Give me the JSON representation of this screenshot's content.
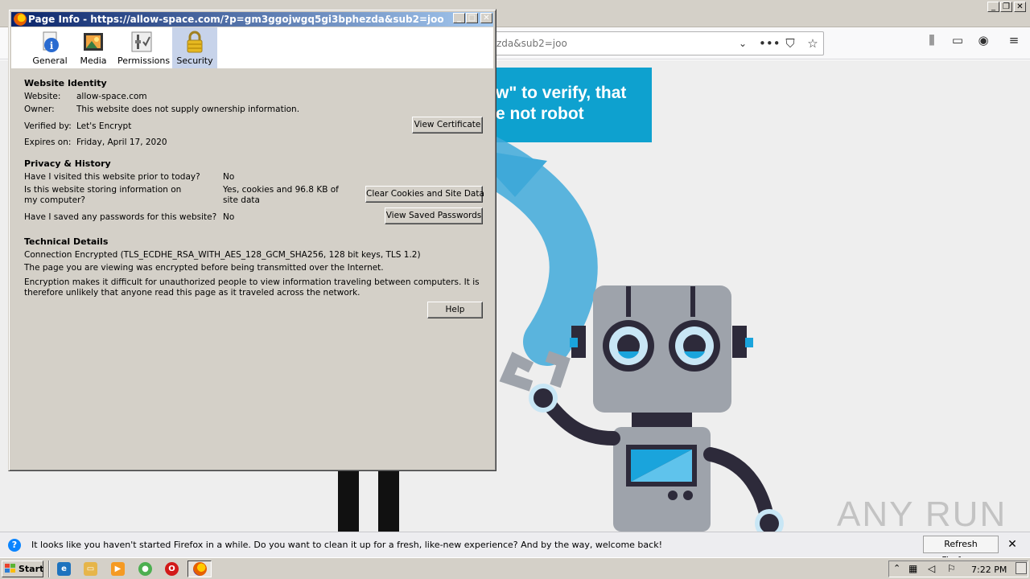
{
  "firefox": {
    "url_partial": "zda&sub2=joo",
    "page": {
      "banner_line1": "w\" to verify, that",
      "banner_line2": "e not robot"
    },
    "watermark": "ANY RUN"
  },
  "dialog": {
    "title": "Page Info - https://allow-space.com/?p=gm3ggojwgq5gi3bphezda&sub2=joo",
    "tabs": [
      {
        "label": "General",
        "icon": "info-icon"
      },
      {
        "label": "Media",
        "icon": "media-icon"
      },
      {
        "label": "Permissions",
        "icon": "permissions-icon"
      },
      {
        "label": "Security",
        "icon": "lock-icon",
        "selected": true
      }
    ],
    "identity": {
      "heading": "Website Identity",
      "website_label": "Website:",
      "website_value": "allow-space.com",
      "owner_label": "Owner:",
      "owner_value": "This website does not supply ownership information.",
      "verified_label": "Verified by:",
      "verified_value": "Let's Encrypt",
      "expires_label": "Expires on:",
      "expires_value": "Friday, April 17, 2020",
      "view_cert_button": "View Certificate"
    },
    "privacy": {
      "heading": "Privacy & History",
      "visited_q": "Have I visited this website prior to today?",
      "visited_a": "No",
      "storing_q": "Is this website storing information on my computer?",
      "storing_a": "Yes, cookies and 96.8 KB of site data",
      "clear_button": "Clear Cookies and Site Data",
      "passwords_q": "Have I saved any passwords for this website?",
      "passwords_a": "No",
      "view_passwords_button": "View Saved Passwords"
    },
    "technical": {
      "heading": "Technical Details",
      "line1": "Connection Encrypted (TLS_ECDHE_RSA_WITH_AES_128_GCM_SHA256, 128 bit keys, TLS 1.2)",
      "line2": "The page you are viewing was encrypted before being transmitted over the Internet.",
      "line3": "Encryption makes it difficult for unauthorized people to view information traveling between computers. It is therefore unlikely that anyone read this page as it traveled across the network.",
      "help_button": "Help"
    }
  },
  "notification": {
    "text": "It looks like you haven't started Firefox in a while. Do you want to clean it up for a fresh, like-new experience? And by the way, welcome back!",
    "button": "Refresh Firefox…"
  },
  "taskbar": {
    "start_label": "Start",
    "clock": "7:22 PM"
  },
  "colors": {
    "banner": "#0ea1cf",
    "title_gradient_start": "#0a246a",
    "dialog_face": "#d4d0c8"
  }
}
